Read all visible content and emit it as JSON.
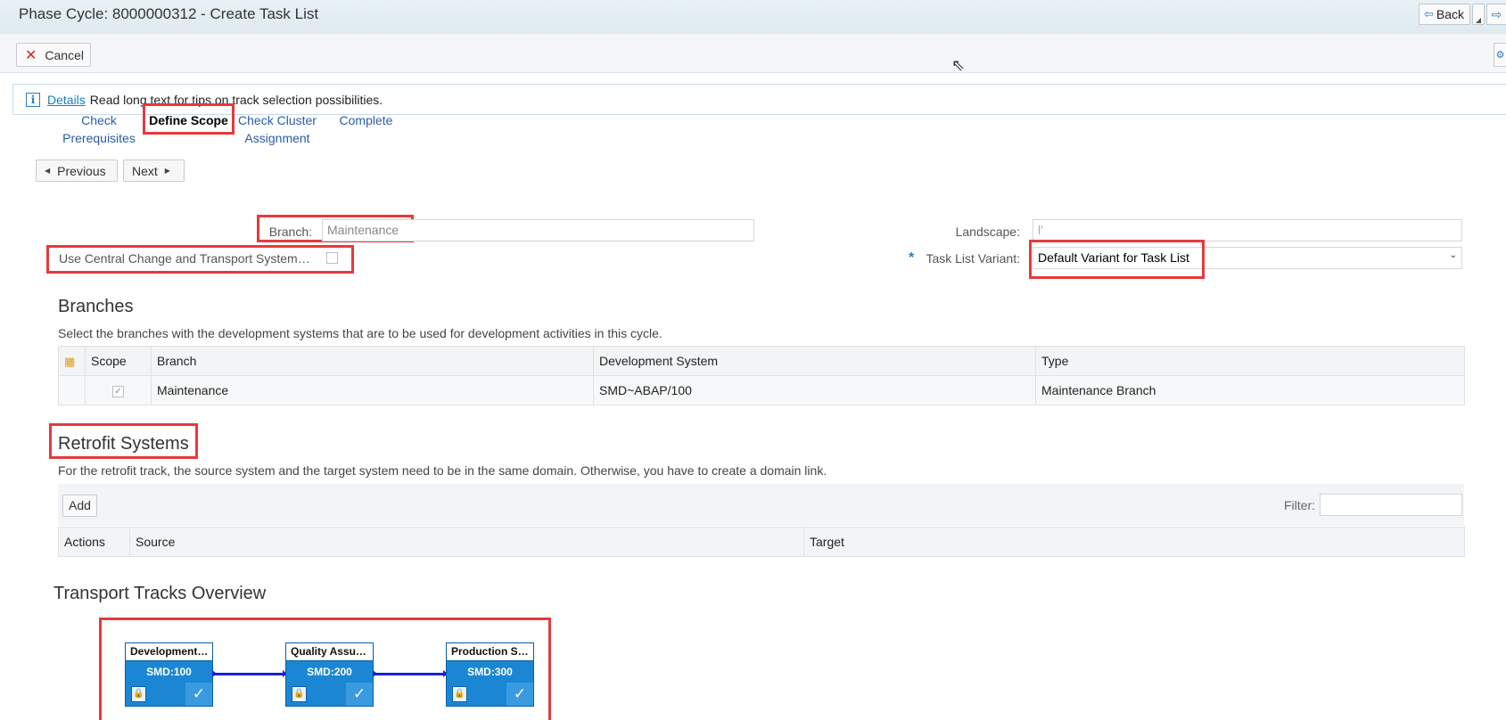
{
  "window": {
    "title": "Phase Cycle: 8000000312 - Create Task List",
    "back_label": "Back"
  },
  "toolbar": {
    "cancel_label": "Cancel"
  },
  "info": {
    "link_label": "Details",
    "message": "Read long text for tips on track selection possibilities."
  },
  "roadmap": {
    "steps": [
      {
        "label": "Check Prerequisites"
      },
      {
        "label": "Define Scope"
      },
      {
        "label": "Check Cluster Assignment"
      },
      {
        "label": "Complete"
      }
    ],
    "previous_label": "Previous",
    "next_label": "Next"
  },
  "form": {
    "branch_label": "Branch:",
    "branch_value": "Maintenance",
    "use_ccts_label": "Use Central Change and Transport System…",
    "landscape_label": "Landscape:",
    "landscape_value": "l'",
    "task_list_variant_label": "Task List Variant:",
    "task_list_variant_value": "Default Variant for Task List",
    "required_mark": "*"
  },
  "branches": {
    "title": "Branches",
    "description": "Select the branches with the development systems that are to be used for development activities in this cycle.",
    "columns": [
      "Scope",
      "Branch",
      "Development System",
      "Type"
    ],
    "rows": [
      {
        "branch": "Maintenance",
        "dev_system": "SMD~ABAP/100",
        "type": "Maintenance Branch"
      }
    ]
  },
  "retrofit": {
    "title": "Retrofit Systems",
    "description": "For the retrofit track, the source system and the target system need to be in the same domain. Otherwise, you have to create a domain link.",
    "add_label": "Add",
    "filter_label": "Filter:",
    "columns": [
      "Actions",
      "Source",
      "Target"
    ]
  },
  "tracks": {
    "title": "Transport Tracks Overview",
    "nodes": [
      {
        "name": "Development…",
        "system": "SMD:100"
      },
      {
        "name": "Quality Assu…",
        "system": "SMD:200"
      },
      {
        "name": "Production S…",
        "system": "SMD:300"
      }
    ]
  },
  "colors": {
    "accent": "#2b7bc2",
    "highlight": "#e7393b",
    "node_blue": "#1b87d4"
  }
}
